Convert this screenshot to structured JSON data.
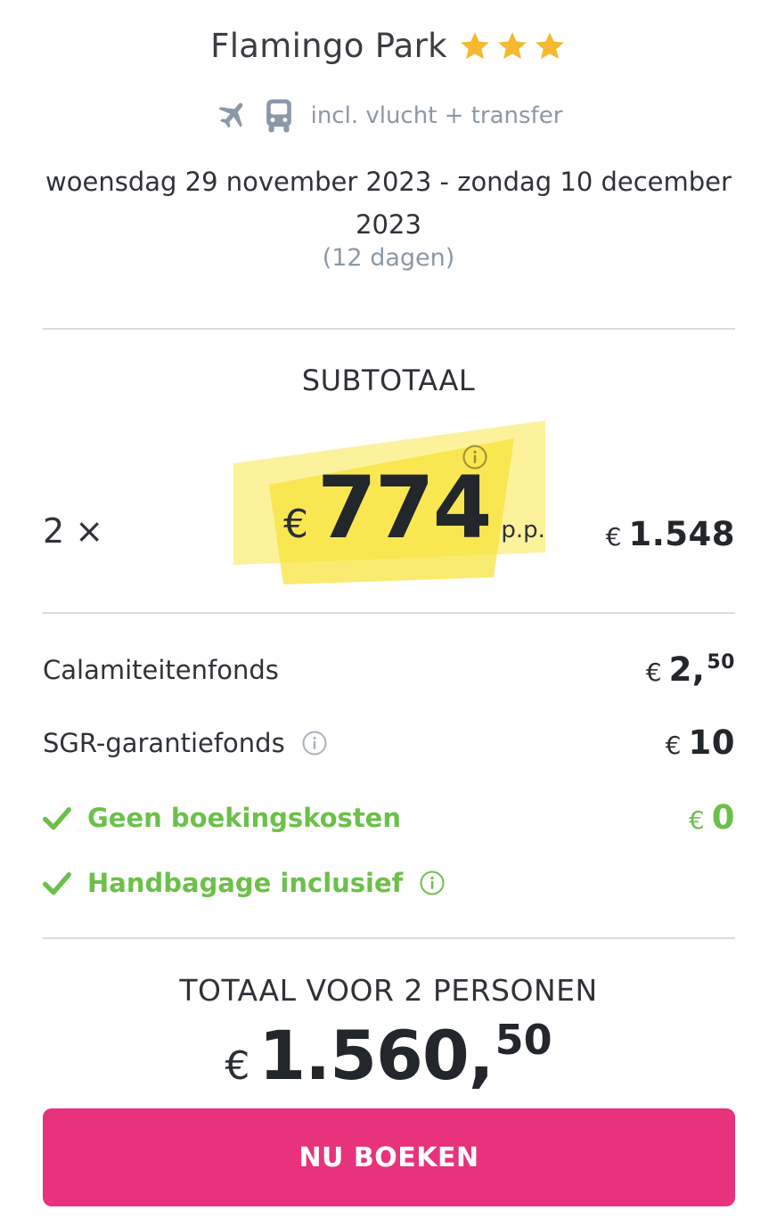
{
  "hotel": {
    "name": "Flamingo Park",
    "stars": 3
  },
  "inclusions": {
    "icons": [
      "plane-icon",
      "bus-icon"
    ],
    "text": "incl. vlucht + transfer"
  },
  "dates": {
    "range": "woensdag 29 november 2023 - zondag 10 december 2023",
    "duration": "(12 dagen)"
  },
  "subtotal": {
    "label": "SUBTOTAAL",
    "quantity": "2 ×",
    "currency": "€",
    "price_per_person": "774",
    "pp_label": "p.p.",
    "line_total": "1.548"
  },
  "fees": [
    {
      "label": "Calamiteitenfonds",
      "currency": "€",
      "amount": "2,",
      "cents": "50"
    },
    {
      "label": "SGR-garantiefonds",
      "currency": "€",
      "amount": "10"
    },
    {
      "label": "Geen boekingskosten",
      "currency": "€",
      "amount": "0"
    },
    {
      "label": "Handbagage inclusief"
    }
  ],
  "total": {
    "label": "TOTAAL VOOR 2 PERSONEN",
    "currency": "€",
    "amount": "1.560,",
    "cents": "50"
  },
  "book_button": {
    "label": "NU BOEKEN"
  },
  "colors": {
    "accent_pink": "#e8327c",
    "green": "#6cc04a",
    "star": "#f5b82e",
    "highlight": "#fbe84a",
    "muted": "#8b98a6",
    "divider": "#d3dde6"
  }
}
